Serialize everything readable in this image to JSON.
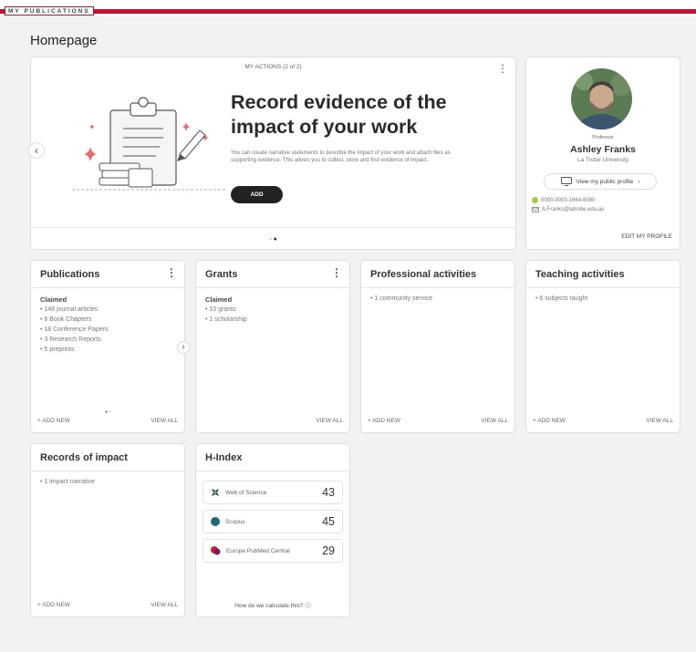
{
  "app": {
    "brand": "MY PUBLICATIONS",
    "page_title": "Homepage",
    "accent": "#c8102e"
  },
  "hero": {
    "label": "MY ACTIONS (2 of 2)",
    "heading_line1": "Record evidence of the",
    "heading_line2": "impact of your work",
    "description": "You can create narrative statements to describe the impact of your work and attach files as supporting evidence. This allows you to collect, store and find evidence of impact.",
    "button": "ADD",
    "prev": "‹",
    "dots": "◦ ●"
  },
  "profile": {
    "role": "Professor",
    "name": "Ashley Franks",
    "university": "La Trobe University",
    "view_profile": "View my public profile",
    "orcid": "0000-0003-1664-6080",
    "email": "A.Franks@latrobe.edu.au",
    "edit": "EDIT MY PROFILE"
  },
  "publications": {
    "title": "Publications",
    "claimed": "Claimed",
    "items": [
      "• 148 journal articles",
      "• 6 Book Chapters",
      "• 18 Conference Papers",
      "• 3 Research Reports",
      "• 5 preprints"
    ],
    "add_new": "+ ADD NEW",
    "view_all": "VIEW ALL",
    "dots": "● ◦",
    "next": "›"
  },
  "grants": {
    "title": "Grants",
    "claimed": "Claimed",
    "items": [
      "• 10 grants",
      "• 1 scholarship"
    ],
    "view_all": "VIEW ALL"
  },
  "professional": {
    "title": "Professional activities",
    "items": [
      "• 1 community service"
    ],
    "add_new": "+ ADD NEW",
    "view_all": "VIEW ALL"
  },
  "teaching": {
    "title": "Teaching activities",
    "items": [
      "• 6 subjects taught"
    ],
    "add_new": "+ ADD NEW",
    "view_all": "VIEW ALL"
  },
  "impact": {
    "title": "Records of impact",
    "items": [
      "• 1 impact narrative"
    ],
    "add_new": "+ ADD NEW",
    "view_all": "VIEW ALL"
  },
  "hindex": {
    "title": "H-Index",
    "rows": [
      {
        "name": "Web of Science",
        "value": "43"
      },
      {
        "name": "Scopus",
        "value": "45"
      },
      {
        "name": "Europe PubMed Central",
        "value": "29"
      }
    ],
    "calc": "How do we calculate this? ⓘ"
  }
}
